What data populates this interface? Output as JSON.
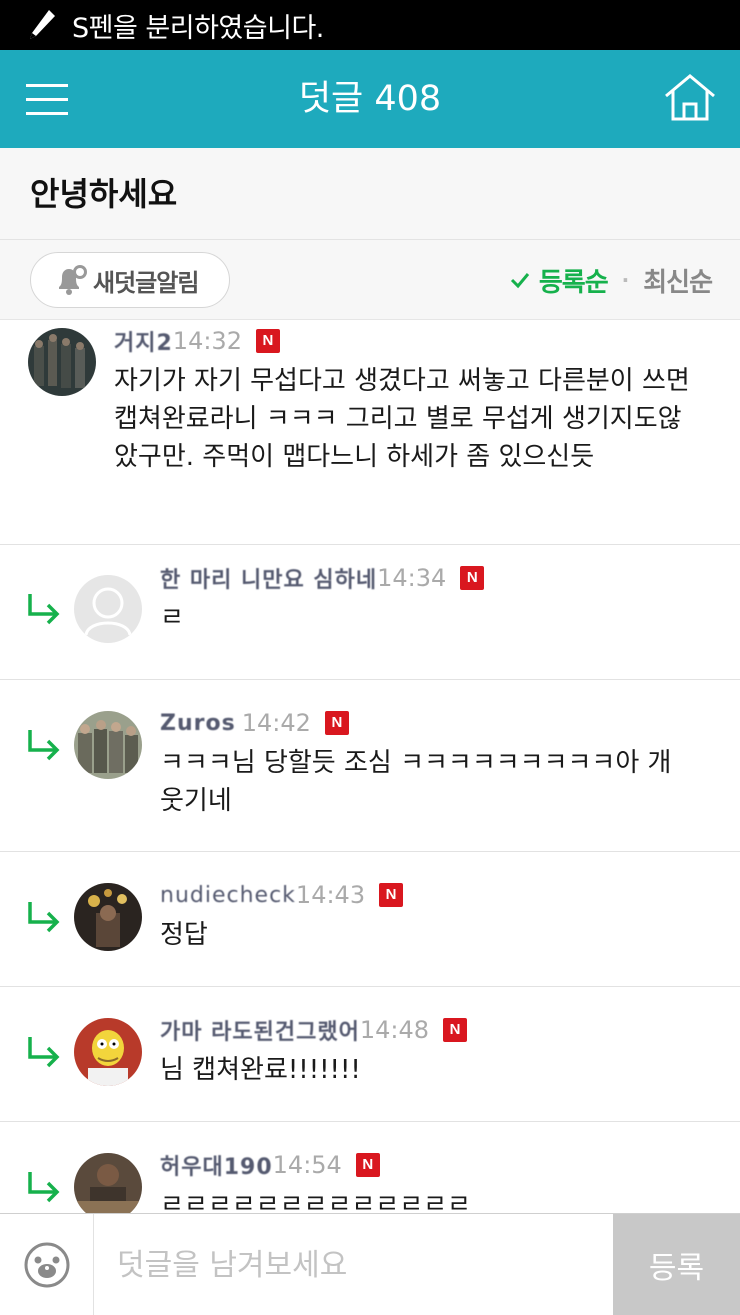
{
  "status_bar": {
    "pen_icon": "pen-icon",
    "message": "S펜을 분리하였습니다."
  },
  "app_bar": {
    "title": "덧글 408",
    "menu_icon": "hamburger-menu-icon",
    "home_icon": "home-icon",
    "accent": "#1eaabd"
  },
  "post": {
    "title": "안녕하세요"
  },
  "toolbar": {
    "alarm_label": "새덧글알림",
    "sort_active": "등록순",
    "sort_separator": "·",
    "sort_inactive": "최신순",
    "active_color": "#16b14c"
  },
  "comments": [
    {
      "nickname": "거지2",
      "time": "14:32",
      "badge": "N",
      "text": "자기가 자기 무섭다고 생겼다고 써놓고 다른분이 쓰면 캡쳐완료라니 ㅋㅋㅋ 그리고 별로 무섭게 생기지도않았구만. 주먹이 맵다느니 하세가 좀 있으신듯",
      "reply": false
    },
    {
      "nickname": "한 마리 니만요 심하네",
      "time": "14:34",
      "badge": "N",
      "text": "ㄹ",
      "reply": true
    },
    {
      "nickname": "Zuros",
      "time": "14:42",
      "badge": "N",
      "text": "ㅋㅋㅋ님 당할듯 조심 ㅋㅋㅋㅋㅋㅋㅋㅋㅋ아 개웃기네",
      "reply": true
    },
    {
      "nickname": "nudiecheck",
      "time": "14:43",
      "badge": "N",
      "text": "정답",
      "reply": true
    },
    {
      "nickname": "가마 라도된건그랬어",
      "time": "14:48",
      "badge": "N",
      "text": "님 캡쳐완료!!!!!!!",
      "reply": true
    },
    {
      "nickname": "허우대190",
      "time": "14:54",
      "badge": "N",
      "text": "ㄹㄹㄹㄹㄹㄹㄹㄹㄹㄹㄹㄹㄹ",
      "reply": true
    }
  ],
  "input_bar": {
    "emoji_icon": "emoticon-icon",
    "placeholder": "덧글을 남겨보세요",
    "submit_label": "등록"
  }
}
